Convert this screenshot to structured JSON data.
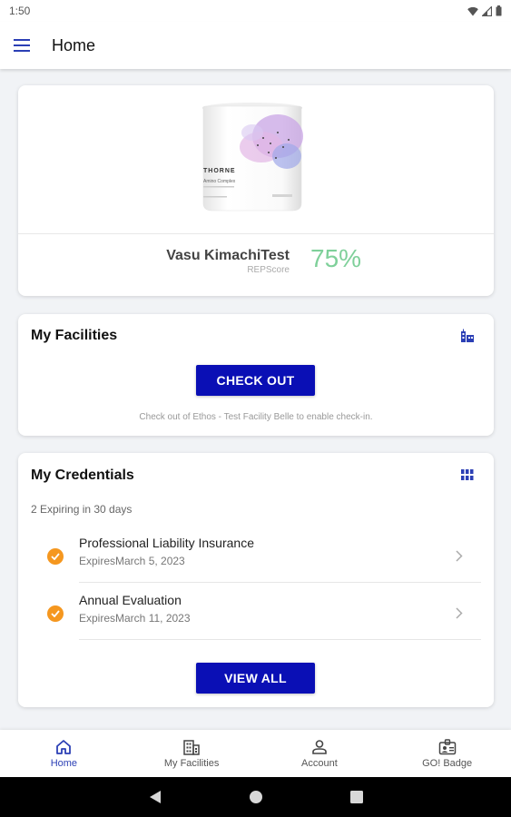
{
  "status_bar": {
    "time": "1:50"
  },
  "app_bar": {
    "title": "Home"
  },
  "profile": {
    "name": "Vasu KimachiTest",
    "score_label": "REPScore",
    "score": "75%",
    "product_brand": "THORNE",
    "product_name": "Amino Complex"
  },
  "facilities": {
    "title": "My Facilities",
    "button": "CHECK OUT",
    "hint": "Check out of Ethos - Test Facility Belle to enable check-in."
  },
  "credentials": {
    "title": "My Credentials",
    "expiring": "2 Expiring in 30 days",
    "items": [
      {
        "name": "Professional Liability Insurance",
        "expires": "ExpiresMarch 5, 2023"
      },
      {
        "name": "Annual Evaluation",
        "expires": "ExpiresMarch 11, 2023"
      }
    ],
    "button": "VIEW ALL"
  },
  "bottom_nav": [
    {
      "label": "Home",
      "icon": "home-icon",
      "active": true
    },
    {
      "label": "My Facilities",
      "icon": "building-icon",
      "active": false
    },
    {
      "label": "Account",
      "icon": "account-icon",
      "active": false
    },
    {
      "label": "GO! Badge",
      "icon": "badge-icon",
      "active": false
    }
  ],
  "colors": {
    "primary_button": "#0a0fb5",
    "score": "#7fd09a",
    "warning": "#f5971f",
    "nav_active": "#2b3fb5"
  }
}
